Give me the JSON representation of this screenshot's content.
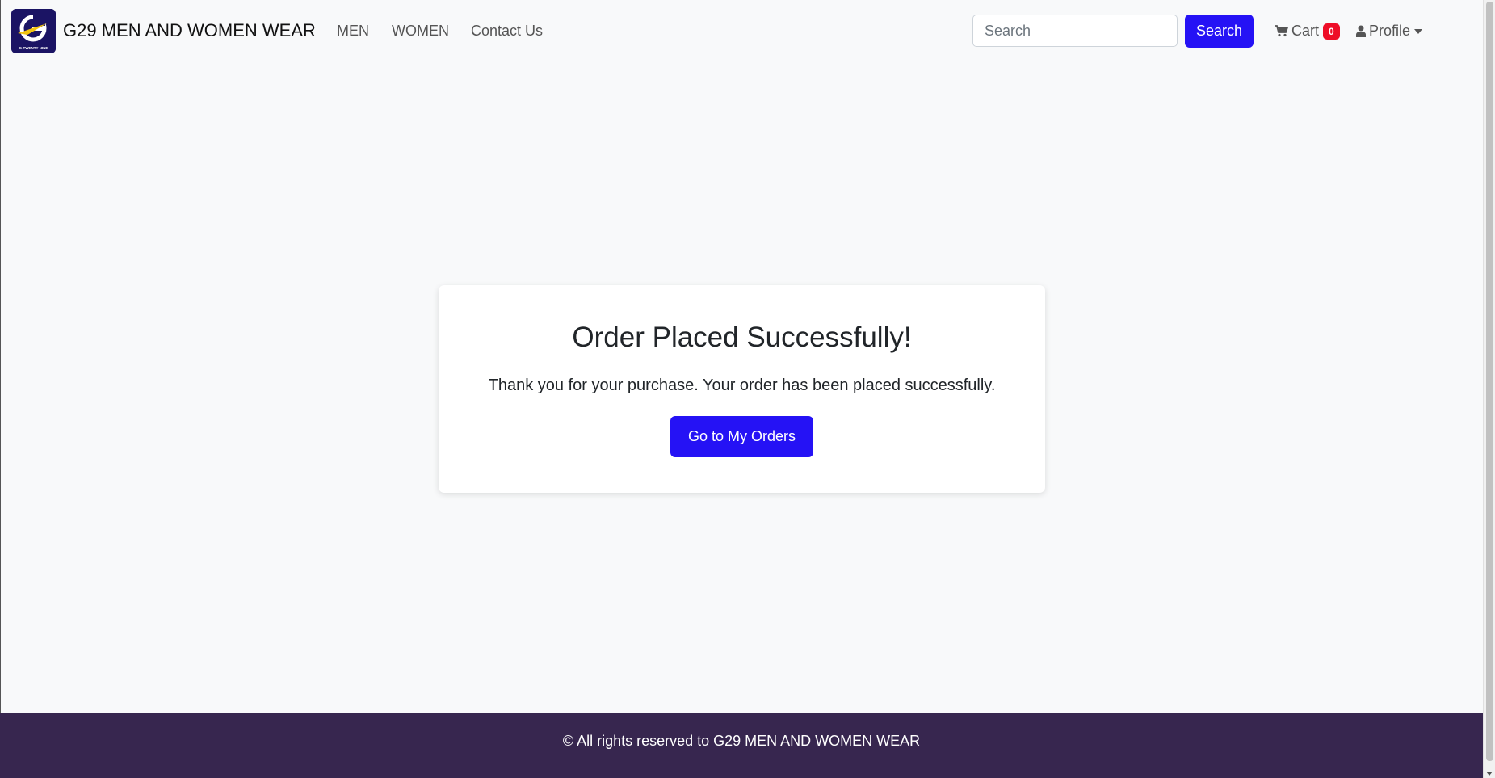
{
  "navbar": {
    "logo_icon": "g29-brand-logo",
    "logo_text": "G-TWENTY NINE",
    "brand": "G29 MEN AND WOMEN WEAR",
    "links": [
      "MEN",
      "WOMEN",
      "Contact Us"
    ],
    "search": {
      "placeholder": "Search",
      "button_label": "Search"
    },
    "cart": {
      "label": "Cart",
      "count": "0",
      "icon": "shopping-cart-icon"
    },
    "profile": {
      "label": "Profile",
      "icon": "user-icon"
    }
  },
  "card": {
    "title": "Order Placed Successfully!",
    "message": "Thank you for your purchase. Your order has been placed successfully.",
    "button_label": "Go to My Orders"
  },
  "footer": {
    "text": "© All rights reserved to G29 MEN AND WOMEN WEAR"
  },
  "colors": {
    "primary": "#2512f5",
    "footer_bg": "#37264f",
    "badge": "#ee0d27",
    "page_bg": "#f8f9fa"
  }
}
